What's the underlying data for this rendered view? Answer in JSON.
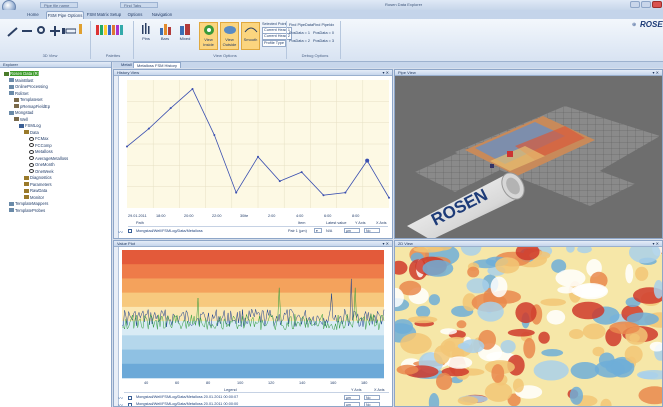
{
  "app": {
    "title": "Rosen Data Explorer",
    "qat_fields": [
      "Pipe file name",
      "Find Tabs"
    ],
    "logo_text": "ROSEN"
  },
  "ribbon": {
    "tabs": [
      "Home",
      "FSM Pipe Options",
      "FSM Matrix Setup",
      "Options",
      "Navigation"
    ],
    "active_tab": "FSM Pipe Options",
    "groups": {
      "view_3d": "3D View",
      "palettes": "Palettes",
      "view_options": "View Options",
      "debug_options": "Debug Options"
    },
    "buttons": {
      "pins": "Pins",
      "bars": "Bars",
      "mixed": "Mixed",
      "view_inside": "View Inside",
      "view_outside": "View Outside",
      "smooth": "Smooth"
    },
    "selected_point": {
      "header": "Selected Point",
      "items": [
        "Current Head 1",
        "Current Head 2"
      ],
      "profile_type": "Profile Type"
    },
    "debug": {
      "find_pipe_data": "Find PipeData",
      "find_pipe_idx": "Find PipeIdx",
      "pos_data_1": "PosData = 1",
      "pos_data_0": "PosData = 0",
      "pos_data_2": "PosData = 2",
      "pos_data_3": "PosData = 3"
    }
  },
  "explorer": {
    "title": "Explorer",
    "items": [
      {
        "label": "Rosen Data (R)",
        "level": 0,
        "selected": true
      },
      {
        "label": "MainBlast",
        "level": 1
      },
      {
        "label": "OnlineProcessing",
        "level": 1
      },
      {
        "label": "RoliSet",
        "level": 1
      },
      {
        "label": "Templateset",
        "level": 2
      },
      {
        "label": "pRemapFieldEp",
        "level": 2
      },
      {
        "label": "Mongstad",
        "level": 1
      },
      {
        "label": "Well",
        "level": 2
      },
      {
        "label": "FSMLog",
        "level": 3
      },
      {
        "label": "Data",
        "level": 4
      },
      {
        "label": "FCMax",
        "level": 5
      },
      {
        "label": "FCComp",
        "level": 5
      },
      {
        "label": "Metalloss",
        "level": 5
      },
      {
        "label": "AverageMetalloss",
        "level": 5
      },
      {
        "label": "OneMonth",
        "level": 5
      },
      {
        "label": "OneWeek",
        "level": 5
      },
      {
        "label": "Diagnostics",
        "level": 4
      },
      {
        "label": "Parameters",
        "level": 4
      },
      {
        "label": "RawData",
        "level": 4
      },
      {
        "label": "Monitor",
        "level": 4
      },
      {
        "label": "TemplateMappers",
        "level": 1
      },
      {
        "label": "TemplateProbes",
        "level": 1
      }
    ]
  },
  "doc_tabs": [
    "Metall",
    "Metalloss FSM History"
  ],
  "history": {
    "title": "History View",
    "x_ticks": [
      "29.01.2011",
      "18:00",
      "20:00",
      "22:00",
      "30ite",
      "2:00",
      "4:00",
      "6:00",
      "8:00"
    ],
    "columns": [
      "Path",
      "Item",
      "Latest value",
      "Y Axis",
      "X Axis"
    ],
    "row": {
      "path": "Mongstad/Well/FSMLog/Data/Metalloss",
      "item": "Pair 1 (µm)",
      "latest": "N/A",
      "y_axis": "µm",
      "x_axis": "No"
    },
    "chart_data": {
      "type": "line",
      "x": [
        0,
        1,
        2,
        3,
        4,
        5,
        6,
        7,
        8,
        9,
        10,
        11,
        12
      ],
      "values": [
        0.48,
        0.62,
        0.78,
        0.93,
        0.57,
        0.12,
        0.4,
        0.21,
        0.28,
        0.1,
        0.12,
        0.37,
        0.08
      ],
      "ylim": [
        0,
        1
      ],
      "grid": true
    }
  },
  "pipe_view": {
    "title": "Pipe View"
  },
  "value_plot": {
    "title": "Value Plot",
    "x_ticks": [
      "40",
      "60",
      "80",
      "100",
      "120",
      "140",
      "160",
      "180"
    ],
    "legend_header": {
      "legend": "Legend",
      "y_axis": "Y Axis",
      "x_axis": "X Axis"
    },
    "rows": [
      {
        "path": "Mongstad/Well/FSMLog/Data/Metalloss 20.01.2011 00:00:07",
        "y_axis": "µm",
        "x_axis": "No"
      },
      {
        "path": "Mongstad/Well/FSMLog/Data/Metalloss 20.01.2011 00:00:00",
        "y_axis": "µm",
        "x_axis": "No"
      }
    ],
    "bands": [
      "#e35a3a",
      "#ee7b49",
      "#f4a25c",
      "#f7c97e",
      "#fbe7b3",
      "#d9ebf5",
      "#b5d7ec",
      "#8fc1e3",
      "#6ca9d8"
    ]
  },
  "d2_view": {
    "title": "2D View"
  }
}
